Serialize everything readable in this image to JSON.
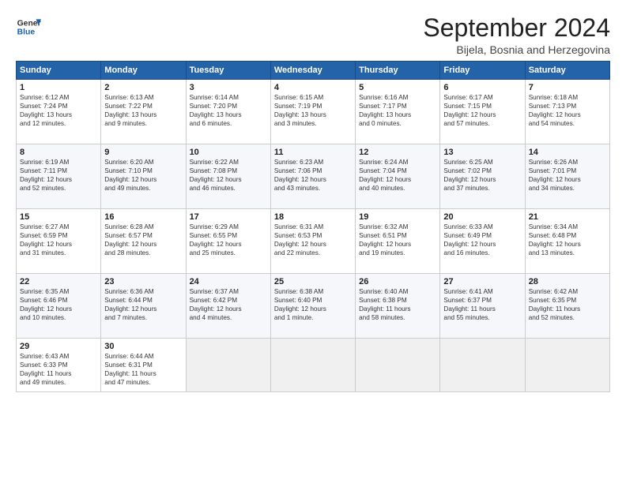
{
  "header": {
    "logo_line1": "General",
    "logo_line2": "Blue",
    "month_title": "September 2024",
    "location": "Bijela, Bosnia and Herzegovina"
  },
  "weekdays": [
    "Sunday",
    "Monday",
    "Tuesday",
    "Wednesday",
    "Thursday",
    "Friday",
    "Saturday"
  ],
  "weeks": [
    [
      {
        "day": "1",
        "info": "Sunrise: 6:12 AM\nSunset: 7:24 PM\nDaylight: 13 hours\nand 12 minutes."
      },
      {
        "day": "2",
        "info": "Sunrise: 6:13 AM\nSunset: 7:22 PM\nDaylight: 13 hours\nand 9 minutes."
      },
      {
        "day": "3",
        "info": "Sunrise: 6:14 AM\nSunset: 7:20 PM\nDaylight: 13 hours\nand 6 minutes."
      },
      {
        "day": "4",
        "info": "Sunrise: 6:15 AM\nSunset: 7:19 PM\nDaylight: 13 hours\nand 3 minutes."
      },
      {
        "day": "5",
        "info": "Sunrise: 6:16 AM\nSunset: 7:17 PM\nDaylight: 13 hours\nand 0 minutes."
      },
      {
        "day": "6",
        "info": "Sunrise: 6:17 AM\nSunset: 7:15 PM\nDaylight: 12 hours\nand 57 minutes."
      },
      {
        "day": "7",
        "info": "Sunrise: 6:18 AM\nSunset: 7:13 PM\nDaylight: 12 hours\nand 54 minutes."
      }
    ],
    [
      {
        "day": "8",
        "info": "Sunrise: 6:19 AM\nSunset: 7:11 PM\nDaylight: 12 hours\nand 52 minutes."
      },
      {
        "day": "9",
        "info": "Sunrise: 6:20 AM\nSunset: 7:10 PM\nDaylight: 12 hours\nand 49 minutes."
      },
      {
        "day": "10",
        "info": "Sunrise: 6:22 AM\nSunset: 7:08 PM\nDaylight: 12 hours\nand 46 minutes."
      },
      {
        "day": "11",
        "info": "Sunrise: 6:23 AM\nSunset: 7:06 PM\nDaylight: 12 hours\nand 43 minutes."
      },
      {
        "day": "12",
        "info": "Sunrise: 6:24 AM\nSunset: 7:04 PM\nDaylight: 12 hours\nand 40 minutes."
      },
      {
        "day": "13",
        "info": "Sunrise: 6:25 AM\nSunset: 7:02 PM\nDaylight: 12 hours\nand 37 minutes."
      },
      {
        "day": "14",
        "info": "Sunrise: 6:26 AM\nSunset: 7:01 PM\nDaylight: 12 hours\nand 34 minutes."
      }
    ],
    [
      {
        "day": "15",
        "info": "Sunrise: 6:27 AM\nSunset: 6:59 PM\nDaylight: 12 hours\nand 31 minutes."
      },
      {
        "day": "16",
        "info": "Sunrise: 6:28 AM\nSunset: 6:57 PM\nDaylight: 12 hours\nand 28 minutes."
      },
      {
        "day": "17",
        "info": "Sunrise: 6:29 AM\nSunset: 6:55 PM\nDaylight: 12 hours\nand 25 minutes."
      },
      {
        "day": "18",
        "info": "Sunrise: 6:31 AM\nSunset: 6:53 PM\nDaylight: 12 hours\nand 22 minutes."
      },
      {
        "day": "19",
        "info": "Sunrise: 6:32 AM\nSunset: 6:51 PM\nDaylight: 12 hours\nand 19 minutes."
      },
      {
        "day": "20",
        "info": "Sunrise: 6:33 AM\nSunset: 6:49 PM\nDaylight: 12 hours\nand 16 minutes."
      },
      {
        "day": "21",
        "info": "Sunrise: 6:34 AM\nSunset: 6:48 PM\nDaylight: 12 hours\nand 13 minutes."
      }
    ],
    [
      {
        "day": "22",
        "info": "Sunrise: 6:35 AM\nSunset: 6:46 PM\nDaylight: 12 hours\nand 10 minutes."
      },
      {
        "day": "23",
        "info": "Sunrise: 6:36 AM\nSunset: 6:44 PM\nDaylight: 12 hours\nand 7 minutes."
      },
      {
        "day": "24",
        "info": "Sunrise: 6:37 AM\nSunset: 6:42 PM\nDaylight: 12 hours\nand 4 minutes."
      },
      {
        "day": "25",
        "info": "Sunrise: 6:38 AM\nSunset: 6:40 PM\nDaylight: 12 hours\nand 1 minute."
      },
      {
        "day": "26",
        "info": "Sunrise: 6:40 AM\nSunset: 6:38 PM\nDaylight: 11 hours\nand 58 minutes."
      },
      {
        "day": "27",
        "info": "Sunrise: 6:41 AM\nSunset: 6:37 PM\nDaylight: 11 hours\nand 55 minutes."
      },
      {
        "day": "28",
        "info": "Sunrise: 6:42 AM\nSunset: 6:35 PM\nDaylight: 11 hours\nand 52 minutes."
      }
    ],
    [
      {
        "day": "29",
        "info": "Sunrise: 6:43 AM\nSunset: 6:33 PM\nDaylight: 11 hours\nand 49 minutes."
      },
      {
        "day": "30",
        "info": "Sunrise: 6:44 AM\nSunset: 6:31 PM\nDaylight: 11 hours\nand 47 minutes."
      },
      {
        "day": "",
        "info": ""
      },
      {
        "day": "",
        "info": ""
      },
      {
        "day": "",
        "info": ""
      },
      {
        "day": "",
        "info": ""
      },
      {
        "day": "",
        "info": ""
      }
    ]
  ]
}
